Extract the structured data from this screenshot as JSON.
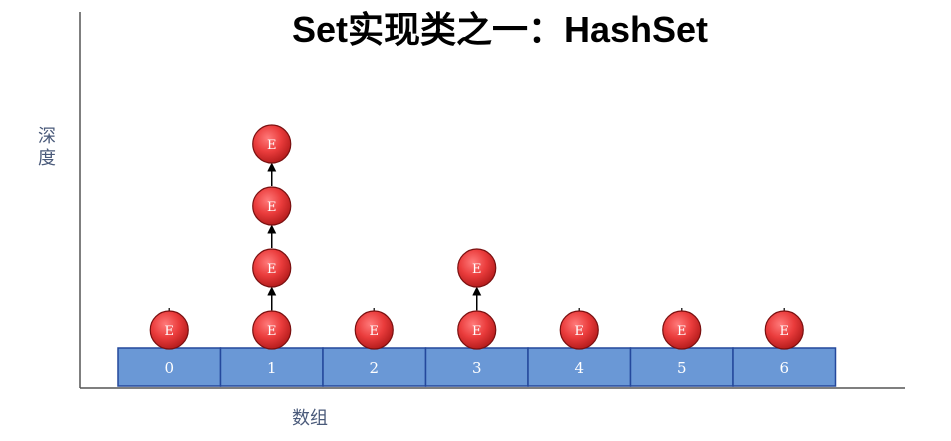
{
  "title": "Set实现类之一：HashSet",
  "y_axis_label": "深度",
  "x_axis_label": "数组",
  "node_label": "E",
  "colors": {
    "slot_fill": "#6a98d6",
    "slot_stroke": "#24489c",
    "node_fill": "#ea3c3c",
    "node_stroke": "#7a1010",
    "axis": "#555555",
    "label_text": "#4a5a7a"
  },
  "array": {
    "slots": [
      {
        "index": "0",
        "chain_length": 1
      },
      {
        "index": "1",
        "chain_length": 4
      },
      {
        "index": "2",
        "chain_length": 1
      },
      {
        "index": "3",
        "chain_length": 2
      },
      {
        "index": "4",
        "chain_length": 1
      },
      {
        "index": "5",
        "chain_length": 1
      },
      {
        "index": "6",
        "chain_length": 1
      }
    ]
  }
}
